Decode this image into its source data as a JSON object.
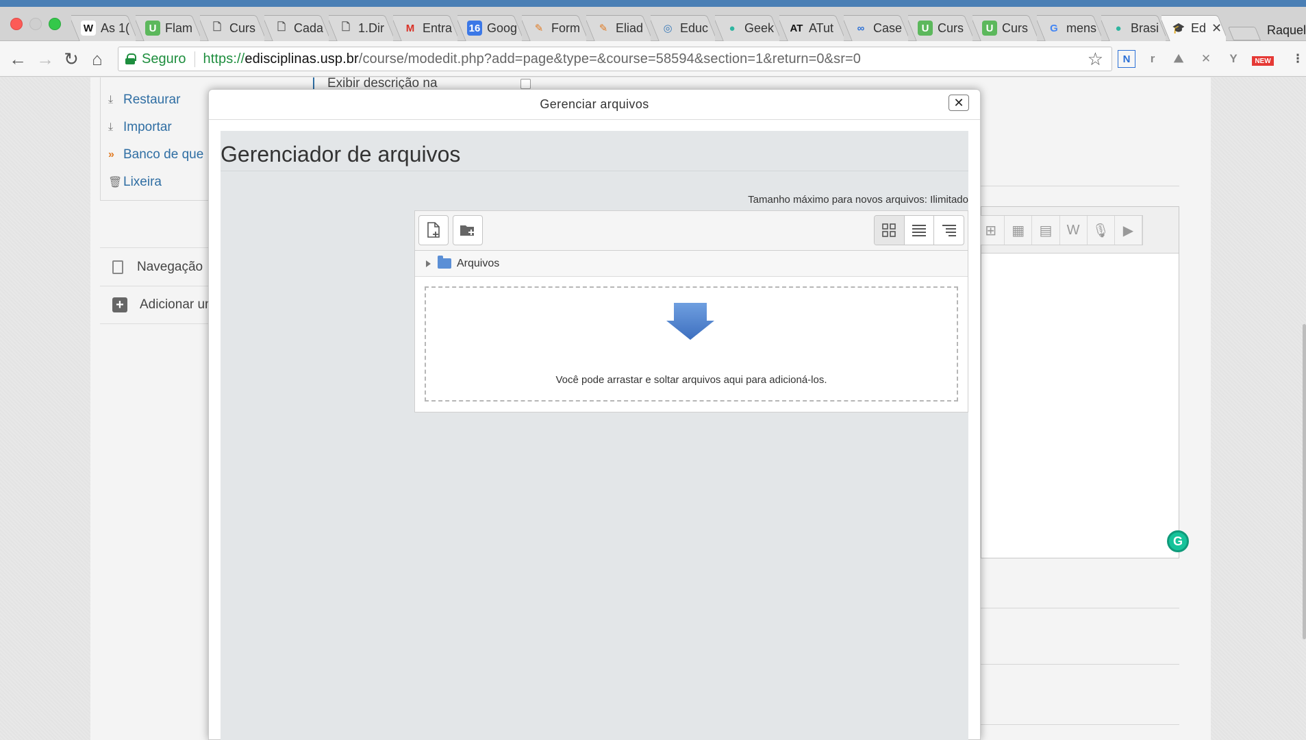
{
  "browser": {
    "tabs": [
      {
        "label": "As 1(",
        "favicon": "W",
        "fav_bg": "#ffffff",
        "fav_color": "#111111",
        "icon": "wikipedia-icon"
      },
      {
        "label": "Flam",
        "favicon": "U",
        "fav_bg": "#5cb85c",
        "fav_color": "#ffffff",
        "icon": "udemy-icon"
      },
      {
        "label": "Curs",
        "favicon": "🗋",
        "fav_bg": "transparent",
        "fav_color": "#555555",
        "icon": "document-icon"
      },
      {
        "label": "Cada",
        "favicon": "🗋",
        "fav_bg": "transparent",
        "fav_color": "#555555",
        "icon": "document-icon"
      },
      {
        "label": "1.Dir",
        "favicon": "🗋",
        "fav_bg": "transparent",
        "fav_color": "#555555",
        "icon": "document-icon"
      },
      {
        "label": "Entra",
        "favicon": "M",
        "fav_bg": "transparent",
        "fav_color": "#d93025",
        "icon": "gmail-icon"
      },
      {
        "label": "Goog",
        "favicon": "16",
        "fav_bg": "#3b78e7",
        "fav_color": "#ffffff",
        "icon": "calendar-icon"
      },
      {
        "label": "Form",
        "favicon": "✎",
        "fav_bg": "transparent",
        "fav_color": "#e07b24",
        "icon": "moodle-icon"
      },
      {
        "label": "Eliad",
        "favicon": "✎",
        "fav_bg": "transparent",
        "fav_color": "#e07b24",
        "icon": "moodle-icon"
      },
      {
        "label": "Educ",
        "favicon": "◎",
        "fav_bg": "transparent",
        "fav_color": "#3a7ab8",
        "icon": "education-icon"
      },
      {
        "label": "Geek",
        "favicon": "●",
        "fav_bg": "transparent",
        "fav_color": "#2fb5a0",
        "icon": "geek-icon"
      },
      {
        "label": "ATut",
        "favicon": "AT",
        "fav_bg": "transparent",
        "fav_color": "#111111",
        "icon": "atutor-icon"
      },
      {
        "label": "Case",
        "favicon": "∞",
        "fav_bg": "transparent",
        "fav_color": "#2a6fd6",
        "icon": "infinity-icon"
      },
      {
        "label": "Curs",
        "favicon": "U",
        "fav_bg": "#5cb85c",
        "fav_color": "#ffffff",
        "icon": "udemy-icon"
      },
      {
        "label": "Curs",
        "favicon": "U",
        "fav_bg": "#5cb85c",
        "fav_color": "#ffffff",
        "icon": "udemy-icon"
      },
      {
        "label": "mens",
        "favicon": "G",
        "fav_bg": "transparent",
        "fav_color": "#4285f4",
        "icon": "google-icon"
      },
      {
        "label": "Brasi",
        "favicon": "●",
        "fav_bg": "transparent",
        "fav_color": "#2fb5a0",
        "icon": "geek-icon"
      },
      {
        "label": "Ed",
        "favicon": "🎓",
        "fav_bg": "transparent",
        "fav_color": "#3a7ab8",
        "icon": "moodle-cap-icon",
        "active": true
      }
    ],
    "profile_name": "Raquel",
    "security_label": "Seguro",
    "url_scheme": "https://",
    "url_host": "edisciplinas.usp.br",
    "url_path": "/course/modedit.php?add=page&type=&course=58594&section=1&return=0&sr=0",
    "extensions": [
      "N",
      "r",
      "⛰",
      "✕",
      "Y",
      "NEW"
    ]
  },
  "page": {
    "sidebar_links": [
      {
        "label": "Restaurar",
        "icon": "restore-icon"
      },
      {
        "label": "Importar",
        "icon": "import-icon"
      },
      {
        "label": "Banco de que",
        "icon": "question-bank-icon"
      },
      {
        "label": "Lixeira",
        "icon": "trash-icon"
      }
    ],
    "nav_label": "Navegação",
    "add_block_label": "Adicionar um",
    "exibir_label": "Exibir descrição na"
  },
  "dialog": {
    "header_title": "Gerenciar arquivos",
    "close_glyph": "✕",
    "fm_title": "Gerenciador de arquivos",
    "max_size": "Tamanho máximo para novos arquivos: Ilimitado",
    "folder_label": "Arquivos",
    "drop_text": "Você pode arrastar e soltar arquivos aqui para adicioná-los.",
    "colors": {
      "accent": "#2f6ea3",
      "drop_arrow": "#5b8fd6",
      "grammarly": "#15c39a"
    }
  }
}
